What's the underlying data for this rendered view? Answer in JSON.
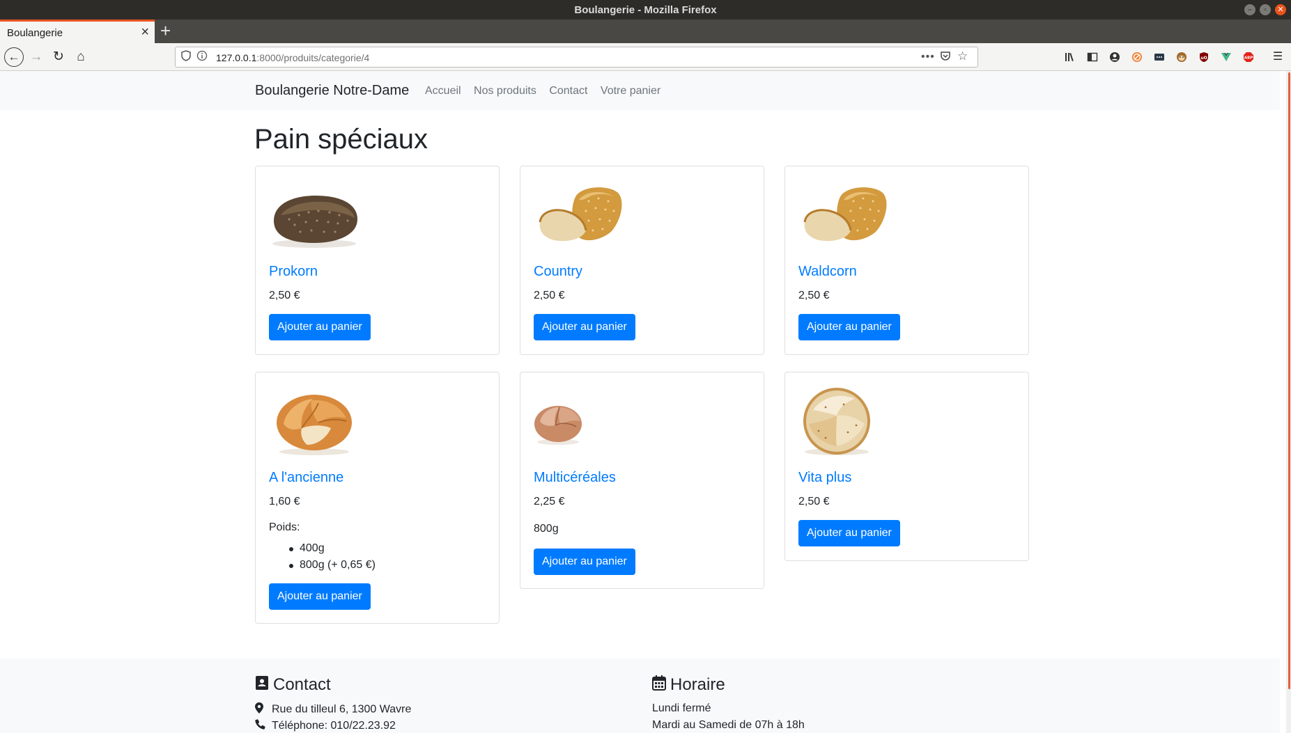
{
  "window": {
    "title": "Boulangerie - Mozilla Firefox"
  },
  "browser": {
    "tab_title": "Boulangerie",
    "url_host": "127.0.0.1",
    "url_path": ":8000/produits/categorie/4"
  },
  "nav": {
    "brand": "Boulangerie Notre-Dame",
    "links": [
      "Accueil",
      "Nos produits",
      "Contact",
      "Votre panier"
    ]
  },
  "page": {
    "title": "Pain spéciaux"
  },
  "products": [
    {
      "name": "Prokorn",
      "price": "2,50 €",
      "button": "Ajouter au panier"
    },
    {
      "name": "Country",
      "price": "2,50 €",
      "button": "Ajouter au panier"
    },
    {
      "name": "Waldcorn",
      "price": "2,50 €",
      "button": "Ajouter au panier"
    },
    {
      "name": "A l'ancienne",
      "price": "1,60 €",
      "weight_label": "Poids:",
      "weights": [
        "400g",
        "800g (+ 0,65 €)"
      ],
      "button": "Ajouter au panier"
    },
    {
      "name": "Multicéréales",
      "price": "2,25 €",
      "weight": "800g",
      "button": "Ajouter au panier"
    },
    {
      "name": "Vita plus",
      "price": "2,50 €",
      "button": "Ajouter au panier"
    }
  ],
  "footer": {
    "contact_title": "Contact",
    "address": "Rue du tilleul 6, 1300 Wavre",
    "phone": "Téléphone: 010/22.23.92",
    "hours_title": "Horaire",
    "hours_line1": "Lundi fermé",
    "hours_line2": "Mardi au Samedi de 07h à 18h"
  },
  "colors": {
    "link": "#007bff",
    "button": "#007bff",
    "firefox_accent": "#e95420"
  }
}
